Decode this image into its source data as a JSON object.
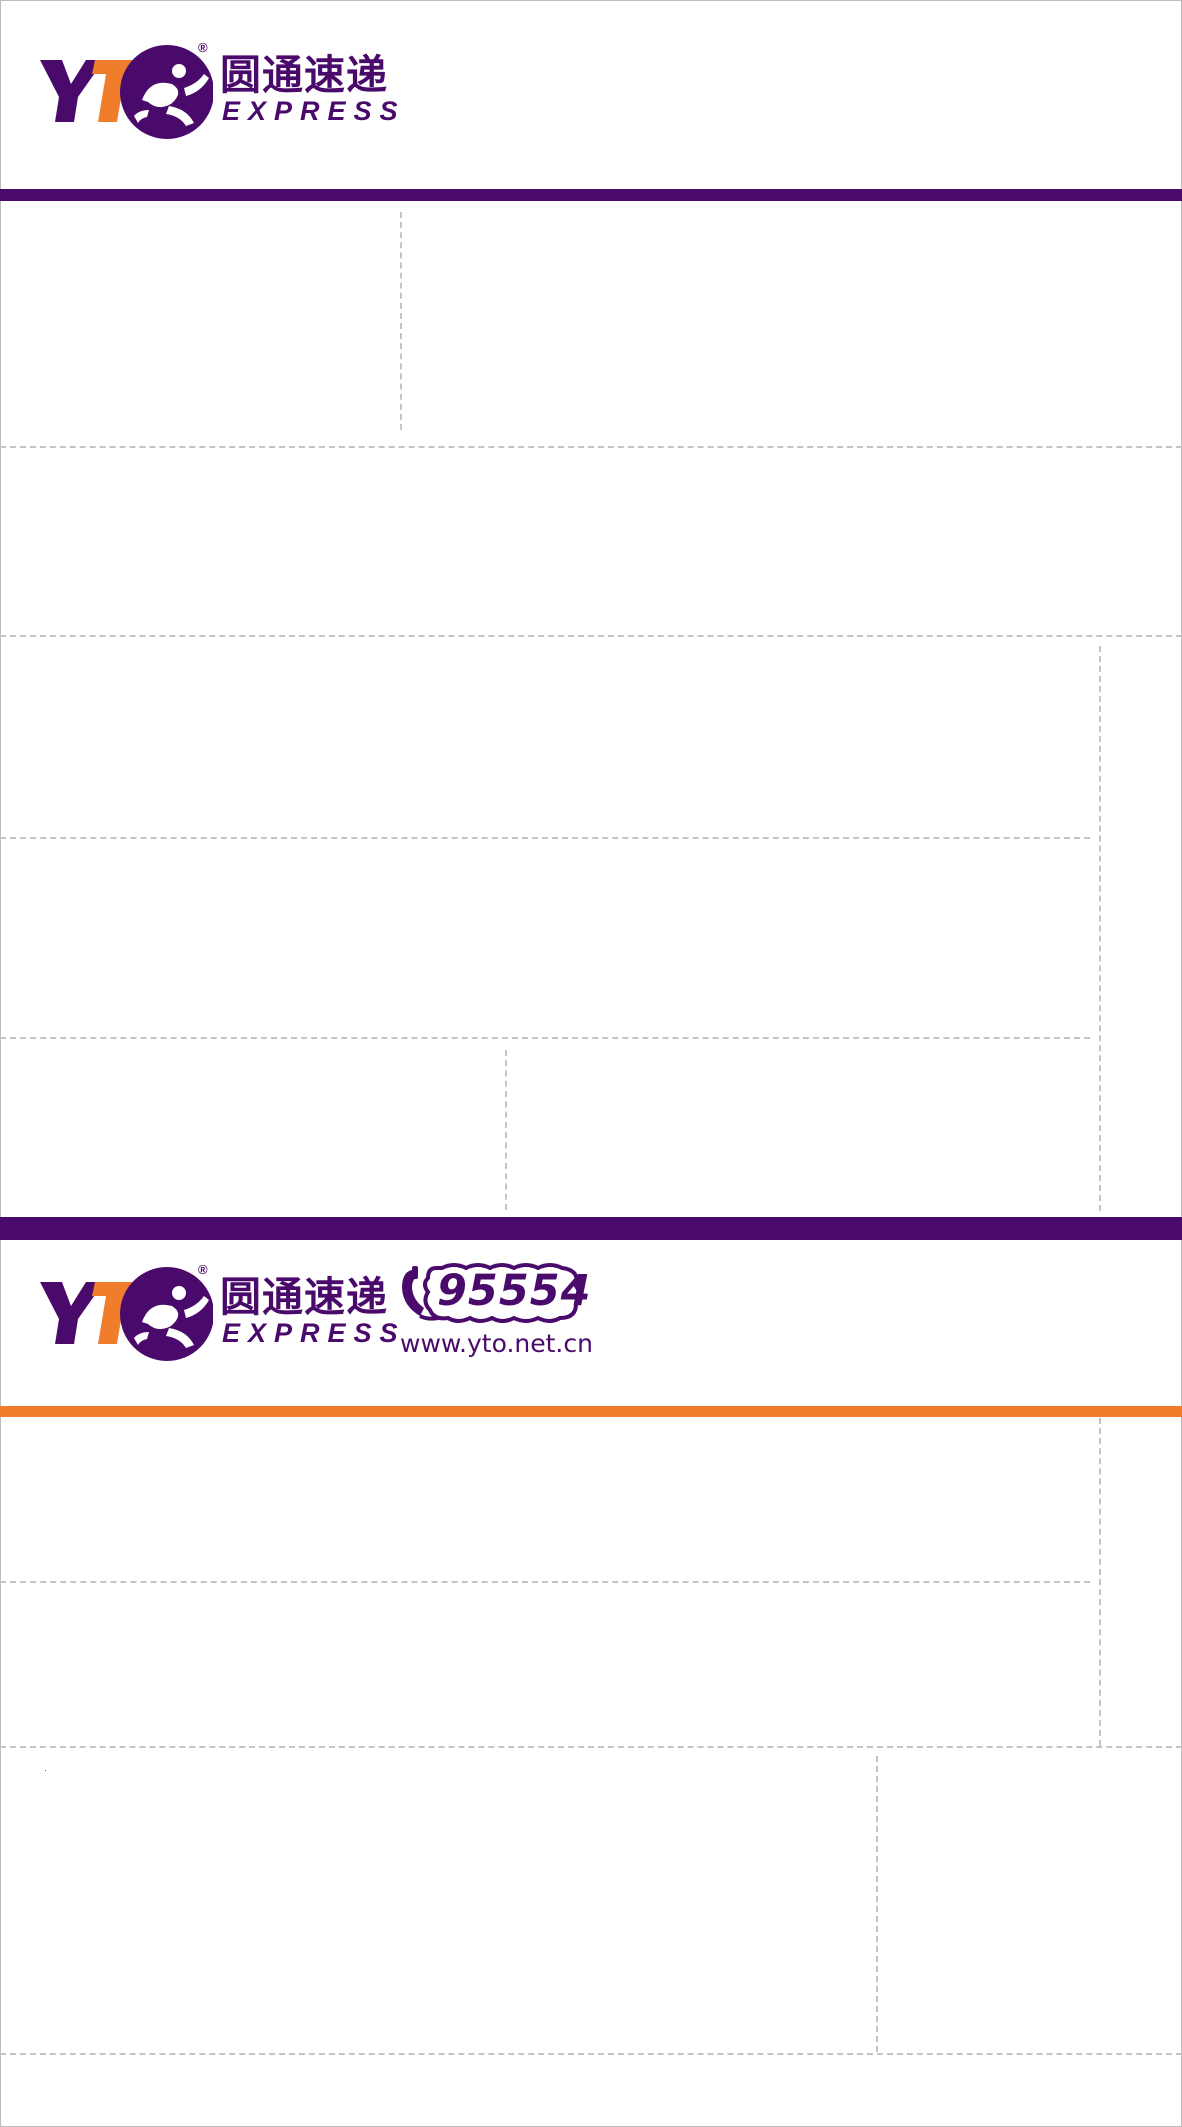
{
  "brand": {
    "initials": "YT",
    "name_cn": "圆通速递",
    "name_en": "EXPRESS",
    "registered_mark": "®",
    "hotline": "95554",
    "website": "www.yto.net.cn"
  },
  "colors": {
    "purple": "#4a0a6b",
    "orange": "#f07d2c",
    "dash": "#c4c4c4",
    "border": "#bdbdbd"
  }
}
